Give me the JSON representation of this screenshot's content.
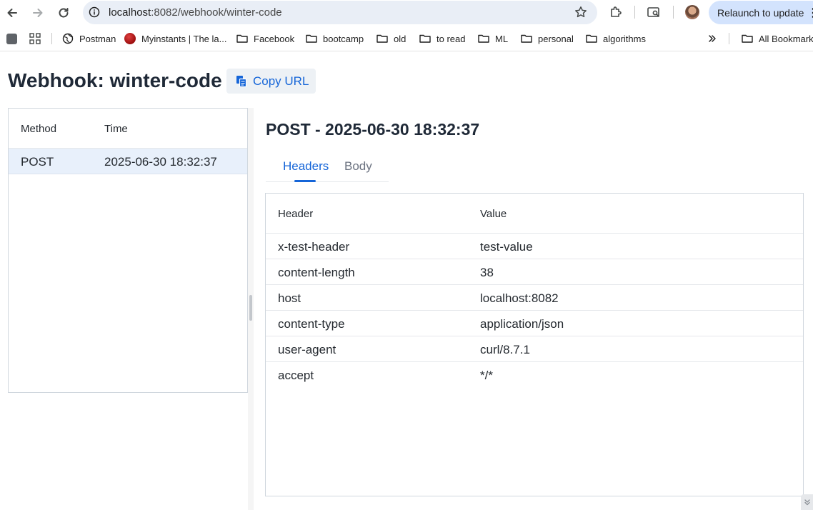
{
  "browser": {
    "url_host": "localhost",
    "url_path": ":8082/webhook/winter-code",
    "relaunch_label": "Relaunch to update",
    "bookmarks": [
      {
        "label": "Postman"
      },
      {
        "label": "Myinstants | The la..."
      },
      {
        "label": "Facebook"
      },
      {
        "label": "bootcamp"
      },
      {
        "label": "old"
      },
      {
        "label": "to read"
      },
      {
        "label": "ML"
      },
      {
        "label": "personal"
      },
      {
        "label": "algorithms"
      }
    ],
    "all_bookmarks_label": "All Bookmarks"
  },
  "page": {
    "title": "Webhook: winter-code",
    "copy_url_label": "Copy URL"
  },
  "requests": {
    "columns": [
      "Method",
      "Time"
    ],
    "rows": [
      {
        "method": "POST",
        "time": "2025-06-30 18:32:37"
      }
    ]
  },
  "detail": {
    "title": "POST - 2025-06-30 18:32:37",
    "tabs": [
      {
        "label": "Headers",
        "active": true
      },
      {
        "label": "Body",
        "active": false
      }
    ],
    "headers_table": {
      "columns": [
        "Header",
        "Value"
      ],
      "rows": [
        {
          "name": "x-test-header",
          "value": "test-value"
        },
        {
          "name": "content-length",
          "value": "38"
        },
        {
          "name": "host",
          "value": "localhost:8082"
        },
        {
          "name": "content-type",
          "value": "application/json"
        },
        {
          "name": "user-agent",
          "value": "curl/8.7.1"
        },
        {
          "name": "accept",
          "value": "*/*"
        }
      ]
    }
  },
  "colors": {
    "accent": "#1565d8",
    "selected_row": "#e8f0fb",
    "relaunch_bg": "#d3e3fd",
    "omnibox_bg": "#e9eef6"
  }
}
